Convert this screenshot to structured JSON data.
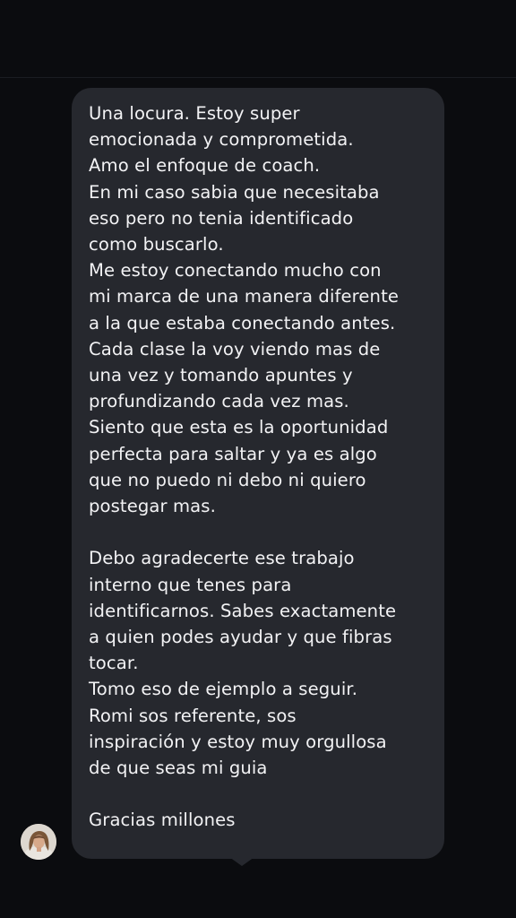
{
  "message": {
    "lines": [
      "Una locura. Estoy super",
      "emocionada y comprometida.",
      "Amo el enfoque de coach.",
      "En mi caso sabia que necesitaba",
      "eso pero no tenia identificado",
      "como buscarlo.",
      "Me estoy conectando mucho con",
      "mi marca de una manera diferente",
      "a la que estaba conectando antes.",
      "Cada clase la voy viendo mas de",
      "una vez y tomando apuntes y",
      "profundizando cada vez mas.",
      "Siento que esta es la oportunidad",
      "perfecta para saltar y ya es algo",
      "que no puedo ni debo ni quiero",
      "postegar mas.",
      "",
      "Debo agradecerte ese trabajo",
      "interno que tenes para",
      "identificarnos. Sabes exactamente",
      "a quien podes ayudar y que fibras",
      "tocar.",
      "Tomo eso de ejemplo a seguir.",
      "Romi sos referente, sos",
      "inspiración y estoy muy orgullosa",
      "de que seas mi guia",
      "",
      "Gracias millones"
    ]
  },
  "colors": {
    "background": "#0b0c0f",
    "bubble": "#26282e",
    "text": "#f2f2f4"
  },
  "avatar": {
    "icon": "user-avatar-photo"
  }
}
